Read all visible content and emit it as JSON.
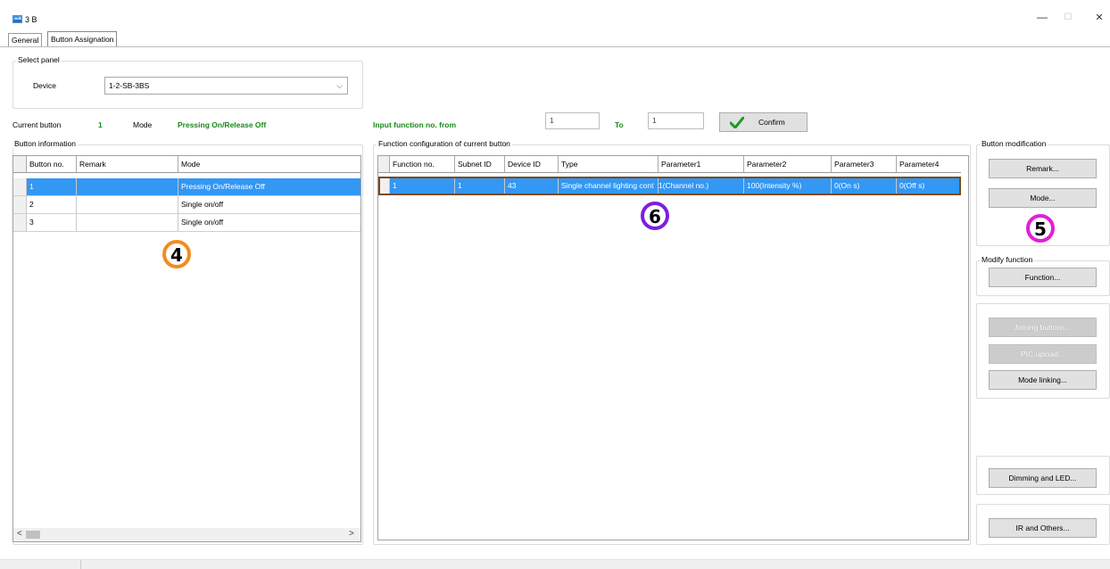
{
  "window": {
    "title": "3 B",
    "minimize_glyph": "—",
    "maximize_glyph": "☐",
    "close_glyph": "✕",
    "icon": "app-icon"
  },
  "tabs": [
    {
      "label": "General",
      "active": false
    },
    {
      "label": "Button Assignation",
      "active": true
    }
  ],
  "select_panel": {
    "title": "Select panel",
    "device_label": "Device",
    "device_value": "1-2-SB-3BS"
  },
  "current": {
    "button_label": "Current button",
    "button_value": "1",
    "mode_label": "Mode",
    "mode_value": "Pressing On/Release Off"
  },
  "input_function": {
    "from_label": "Input function no. from",
    "from_value": "1",
    "to_label": "To",
    "to_value": "1",
    "confirm_label": "Confirm"
  },
  "button_information": {
    "title": "Button information",
    "columns": [
      "Button no.",
      "Remark",
      "Mode"
    ],
    "rows": [
      {
        "no": "1",
        "remark": "",
        "mode": "Pressing On/Release Off",
        "selected": true
      },
      {
        "no": "2",
        "remark": "",
        "mode": "Single on/off",
        "selected": false
      },
      {
        "no": "3",
        "remark": "",
        "mode": "Single on/off",
        "selected": false
      }
    ],
    "scroll_left": "<",
    "scroll_right": ">"
  },
  "function_config": {
    "title": "Function configuration of current button",
    "columns": [
      "Function no.",
      "Subnet ID",
      "Device ID",
      "Type",
      "Parameter1",
      "Parameter2",
      "Parameter3",
      "Parameter4"
    ],
    "rows": [
      [
        "1",
        "1",
        "43",
        "Single channel lighting cont",
        "1(Channel no.)",
        "100(Intensity %)",
        "0(On s)",
        "0(Off s)"
      ]
    ]
  },
  "button_modification": {
    "title": "Button modification",
    "remark_btn": "Remark...",
    "mode_btn": "Mode..."
  },
  "modify_function": {
    "title": "Modify function",
    "function_btn": "Function..."
  },
  "extra_buttons": {
    "joining_btn": "Joining buttons...",
    "pic_btn": "PIC upload...",
    "mode_linking_btn": "Mode linking...",
    "dimming_btn": "Dimming and LED...",
    "ir_btn": "IR and Others..."
  },
  "badges": {
    "b4": {
      "text": "4",
      "color": "#f28c1e"
    },
    "b5": {
      "text": "5",
      "color": "#e21fd6"
    },
    "b6": {
      "text": "6",
      "color": "#7c1fe0"
    }
  },
  "colors": {
    "selection": "#3397f4",
    "green_text": "#1a8a1a",
    "confirm_check": "#1e9b1e"
  }
}
